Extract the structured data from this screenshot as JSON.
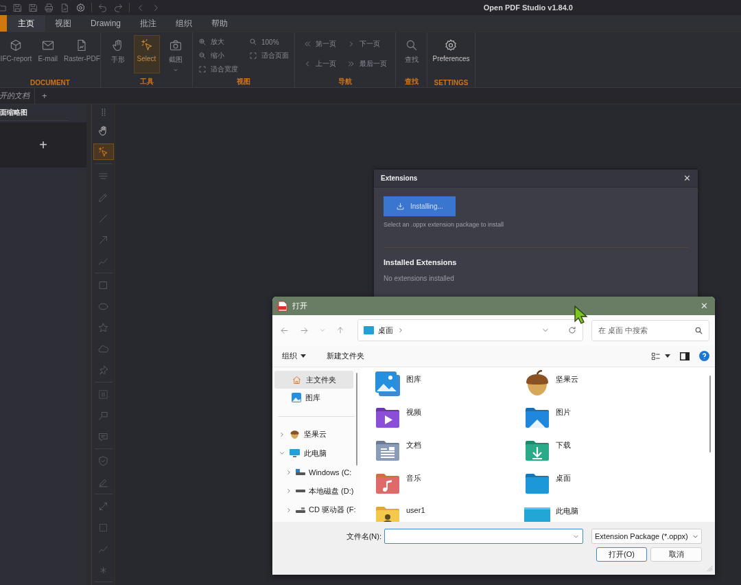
{
  "title_bar": {
    "title": "Open PDF Studio v1.84.0"
  },
  "ribbon_tabs": [
    {
      "label": "主页",
      "selected": true
    },
    {
      "label": "视图",
      "selected": false
    },
    {
      "label": "Drawing",
      "selected": false
    },
    {
      "label": "批注",
      "selected": false
    },
    {
      "label": "组织",
      "selected": false
    },
    {
      "label": "帮助",
      "selected": false
    }
  ],
  "ribbon_groups": [
    {
      "label": "DOCUMENT",
      "items": [
        {
          "label": "IFC-report",
          "kind": "large",
          "disabled": true
        },
        {
          "label": "E-mail",
          "kind": "large",
          "disabled": true
        },
        {
          "label": "Raster-PDF",
          "kind": "large",
          "disabled": true
        }
      ]
    },
    {
      "label": "工具",
      "items": [
        {
          "label": "手形",
          "kind": "large",
          "disabled": true,
          "selected": false
        },
        {
          "label": "Select",
          "kind": "large",
          "disabled": true,
          "selected": true
        },
        {
          "label": "截图",
          "kind": "split",
          "disabled": true,
          "selected": false
        }
      ]
    },
    {
      "label": "视图",
      "items": [
        {
          "label": "放大",
          "kind": "small",
          "disabled": true
        },
        {
          "label": "缩小",
          "kind": "small",
          "disabled": true
        },
        {
          "label": "适合宽度",
          "kind": "small",
          "disabled": true
        },
        {
          "label": "100%",
          "kind": "small",
          "disabled": true
        },
        {
          "label": "适合页面",
          "kind": "small",
          "disabled": true
        }
      ]
    },
    {
      "label": "导航",
      "items": [
        {
          "label": "第一页",
          "kind": "small",
          "disabled": true
        },
        {
          "label": "上一页",
          "kind": "small",
          "disabled": true
        },
        {
          "label": "下一页",
          "kind": "small",
          "disabled": true
        },
        {
          "label": "最后一页",
          "kind": "small",
          "disabled": true
        }
      ]
    },
    {
      "label": "查找",
      "items": [
        {
          "label": "查找",
          "kind": "large",
          "disabled": true
        }
      ]
    },
    {
      "label": "SETTINGS",
      "items": [
        {
          "label": "Preferences",
          "kind": "large",
          "disabled": false
        }
      ]
    }
  ],
  "doc_tabs": {
    "tabs": [
      {
        "label": "开的文档"
      }
    ],
    "add_label": "+"
  },
  "thumbnails_panel": {
    "title": "面缩略图",
    "add_label": "+"
  },
  "tool_strip": [
    {
      "tools": [
        {
          "selected": false
        },
        {
          "selected": true
        }
      ]
    },
    {
      "tools": [
        {
          "selected": false
        },
        {
          "selected": false
        },
        {
          "selected": false
        },
        {
          "selected": false
        },
        {
          "selected": false
        }
      ]
    },
    {
      "tools": [
        {
          "selected": false
        },
        {
          "selected": false
        },
        {
          "selected": false
        },
        {
          "selected": false
        },
        {
          "selected": false
        }
      ]
    },
    {
      "tools": [
        {
          "selected": false
        },
        {
          "selected": false
        },
        {
          "selected": false
        }
      ]
    },
    {
      "tools": [
        {
          "selected": false
        },
        {
          "selected": false
        }
      ]
    },
    {
      "tools": [
        {
          "selected": false
        },
        {
          "selected": false
        },
        {
          "selected": false
        },
        {
          "selected": false
        }
      ]
    }
  ],
  "extensions_dialog": {
    "title": "Extensions",
    "close": "✕",
    "install_button": {
      "label": "Installing..."
    },
    "hint": "Select an .oppx extension package to install",
    "section_title": "Installed Extensions",
    "empty_text": "No extensions installed"
  },
  "file_dialog": {
    "title": "打开",
    "close": "✕",
    "address": {
      "crumbs": [
        "桌面"
      ]
    },
    "search": {
      "placeholder": "在 桌面 中搜索"
    },
    "toolbar": {
      "organize": "组织",
      "new_folder": "新建文件夹"
    },
    "nav_pinned": [
      {
        "label": "主文件夹",
        "selected": true
      },
      {
        "label": "图库",
        "selected": false
      }
    ],
    "nav_tree": [
      {
        "label": "坚果云",
        "expanded": false,
        "selected": false
      },
      {
        "label": "此电脑",
        "expanded": true,
        "selected": false,
        "children": [
          {
            "label": "Windows (C:",
            "expanded": false,
            "selected": false
          },
          {
            "label": "本地磁盘 (D:)",
            "expanded": false,
            "selected": false
          },
          {
            "label": "CD 驱动器 (F:",
            "expanded": false,
            "selected": false
          }
        ]
      }
    ],
    "items": [
      {
        "label": "图库"
      },
      {
        "label": "坚果云"
      },
      {
        "label": "视频"
      },
      {
        "label": "图片"
      },
      {
        "label": "文档"
      },
      {
        "label": "下载"
      },
      {
        "label": "音乐"
      },
      {
        "label": "桌面"
      },
      {
        "label": "user1"
      },
      {
        "label": "此电脑"
      }
    ],
    "filename": {
      "label": "文件名(N):"
    },
    "file_type": {
      "value": "Extension Package (*.oppx)"
    },
    "buttons": [
      {
        "label": "打开(O)",
        "default": true
      },
      {
        "label": "取消",
        "default": false
      }
    ]
  }
}
